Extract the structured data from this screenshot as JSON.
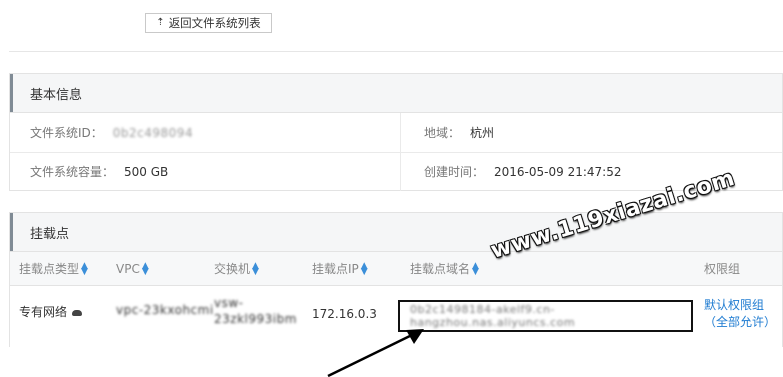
{
  "back_button": {
    "label": "返回文件系统列表",
    "icon": "upload-arrow-icon"
  },
  "basic_info": {
    "title": "基本信息",
    "fs_id_label": "文件系统ID：",
    "fs_id_value": "0b2c498094",
    "region_label": "地域：",
    "region_value": "杭州",
    "capacity_label": "文件系统容量：",
    "capacity_value": "500 GB",
    "created_label": "创建时间：",
    "created_value": "2016-05-09 21:47:52"
  },
  "mount": {
    "title": "挂载点",
    "columns": [
      "挂载点类型",
      "VPC",
      "交换机",
      "挂载点IP",
      "挂载点域名",
      "权限组"
    ],
    "row": {
      "type": "专有网络",
      "vpc": "vpc-23kxohcmi",
      "switch_line1": "vsw-",
      "switch_line2": "23zkl993ibm",
      "ip": "172.16.0.3",
      "domain": "0b2c1498184-akelf9.cn-hangzhou.nas.aliyuncs.com",
      "perm_group": "默认权限组",
      "perm_desc": "（全部允许）"
    }
  },
  "watermark": "www.119xiazai.com",
  "colors": {
    "link": "#1e7bd1",
    "sort": "#3b8fd9",
    "panel_bar": "#808b95"
  }
}
